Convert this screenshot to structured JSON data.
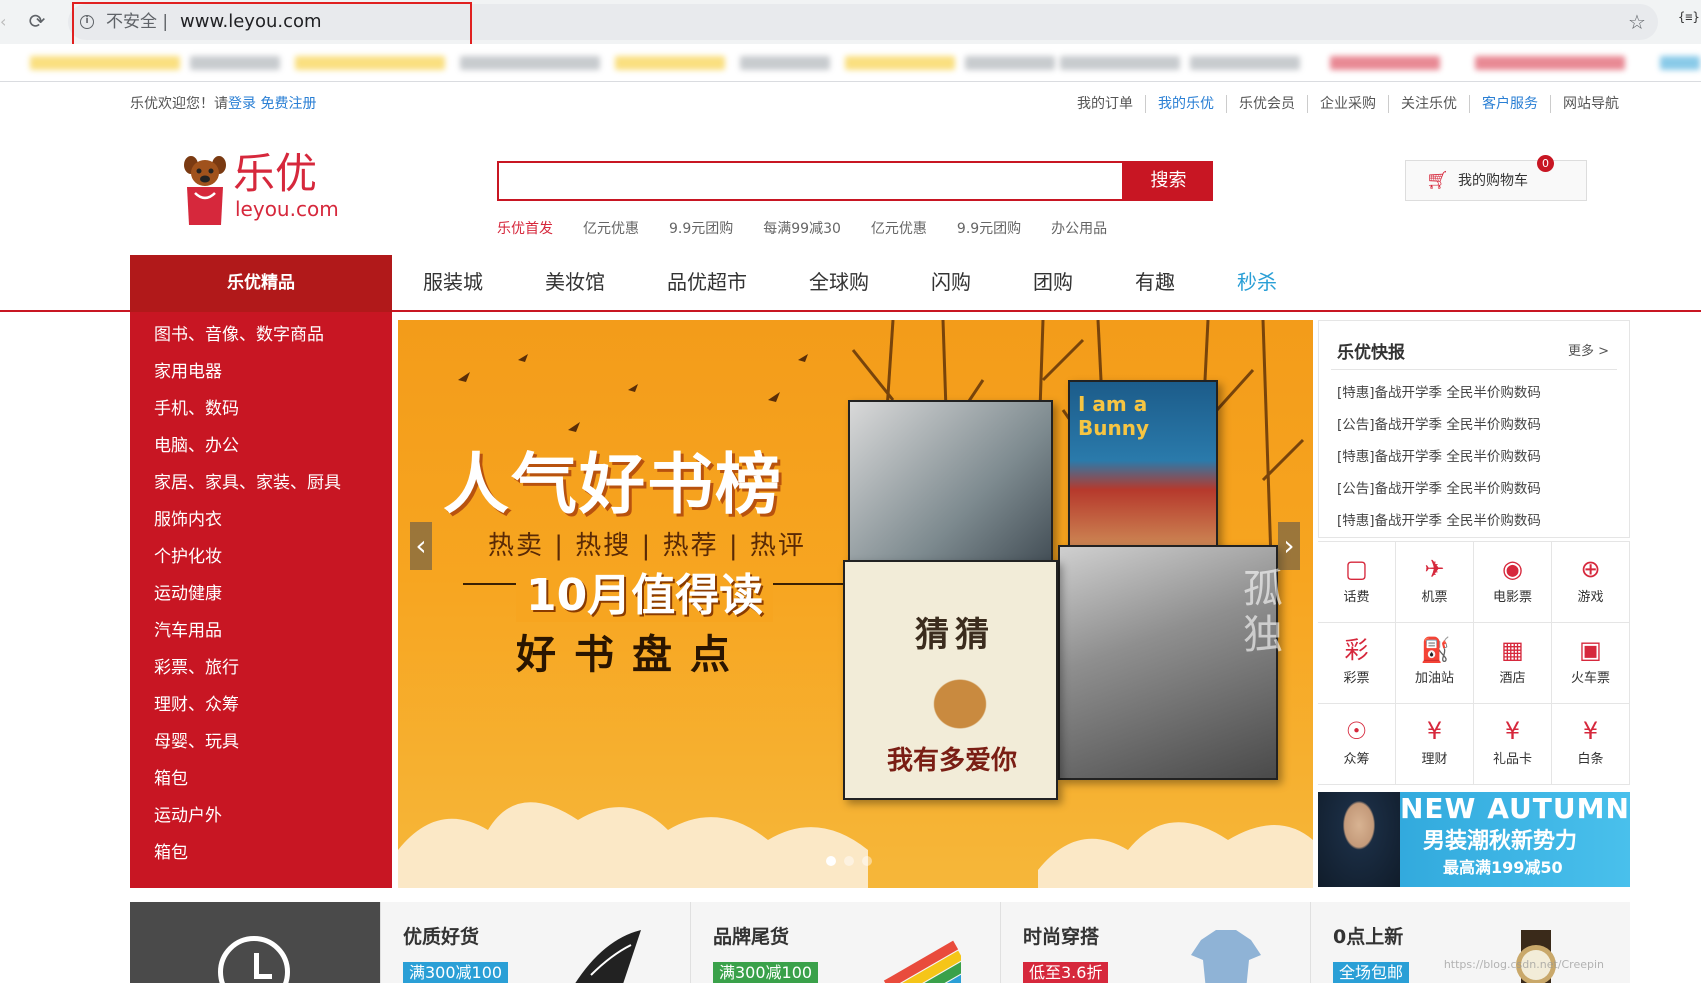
{
  "browser": {
    "security_label": "不安全 |",
    "url": "www.leyou.com"
  },
  "topbar": {
    "welcome_prefix": "乐优欢迎您！请",
    "login": "登录",
    "register": "免费注册",
    "links": [
      "我的订单",
      "我的乐优",
      "乐优会员",
      "企业采购",
      "关注乐优",
      "客户服务",
      "网站导航"
    ]
  },
  "logo": {
    "cn": "乐优",
    "en": "leyou.com"
  },
  "search": {
    "value": "",
    "button": "搜索",
    "hot_words": [
      "乐优首发",
      "亿元优惠",
      "9.9元团购",
      "每满99减30",
      "亿元优惠",
      "9.9元团购",
      "办公用品"
    ]
  },
  "cart": {
    "label": "我的购物车",
    "count": "0"
  },
  "nav": {
    "category_header": "乐优精品",
    "items": [
      "服装城",
      "美妆馆",
      "品优超市",
      "全球购",
      "闪购",
      "团购",
      "有趣",
      "秒杀"
    ]
  },
  "categories": [
    "图书、音像、数字商品",
    "家用电器",
    "手机、数码",
    "电脑、办公",
    "家居、家具、家装、厨具",
    "服饰内衣",
    "个护化妆",
    "运动健康",
    "汽车用品",
    "彩票、旅行",
    "理财、众筹",
    "母婴、玩具",
    "箱包",
    "运动户外",
    "箱包"
  ],
  "banner": {
    "title": "人气好书榜",
    "subtitle": "热卖 | 热搜 | 热荐 | 热评",
    "month": "10月值得读",
    "tagline": "好书盘点",
    "book2_title": "I am a Bunny",
    "book3_title": "猜猜",
    "book3_bottom": "我有多爱你",
    "book4_title": "孤独",
    "arrow_left": "‹",
    "arrow_right": "›"
  },
  "news": {
    "title": "乐优快报",
    "more": "更多 >",
    "items": [
      "[特惠]备战开学季 全民半价购数码",
      "[公告]备战开学季 全民半价购数码",
      "[特惠]备战开学季 全民半价购数码",
      "[公告]备战开学季 全民半价购数码",
      "[特惠]备战开学季 全民半价购数码"
    ]
  },
  "services": [
    {
      "label": "话费",
      "icon": "phone-icon",
      "glyph": "▢"
    },
    {
      "label": "机票",
      "icon": "plane-icon",
      "glyph": "✈"
    },
    {
      "label": "电影票",
      "icon": "film-icon",
      "glyph": "◉"
    },
    {
      "label": "游戏",
      "icon": "gamepad-icon",
      "glyph": "⊕"
    },
    {
      "label": "彩票",
      "icon": "lottery-icon",
      "glyph": "彩"
    },
    {
      "label": "加油站",
      "icon": "gas-station-icon",
      "glyph": "⛽"
    },
    {
      "label": "酒店",
      "icon": "hotel-icon",
      "glyph": "▦"
    },
    {
      "label": "火车票",
      "icon": "train-icon",
      "glyph": "▣"
    },
    {
      "label": "众筹",
      "icon": "crowdfunding-icon",
      "glyph": "☉"
    },
    {
      "label": "理财",
      "icon": "finance-icon",
      "glyph": "¥"
    },
    {
      "label": "礼品卡",
      "icon": "gift-card-icon",
      "glyph": "¥"
    },
    {
      "label": "白条",
      "icon": "credit-icon",
      "glyph": "¥"
    }
  ],
  "ad": {
    "title": "NEW AUTUMN",
    "subtitle": "男装潮秋新势力",
    "subtitle2": "最高满199减50"
  },
  "promos": [
    {
      "title": "优质好货",
      "badge": "满300减100",
      "badge_color": "#2a9fd6"
    },
    {
      "title": "品牌尾货",
      "badge": "满300减100",
      "badge_color": "#3aa14a"
    },
    {
      "title": "时尚穿搭",
      "badge": "低至3.6折",
      "badge_color": "#d6283c"
    },
    {
      "title": "0点上新",
      "badge": "全场包邮",
      "badge_color": "#2a9fd6"
    }
  ],
  "watermark": "https://blog.csdn.net/Creepin",
  "colors": {
    "brand_red": "#c81623",
    "link_blue": "#2a7fd4"
  }
}
